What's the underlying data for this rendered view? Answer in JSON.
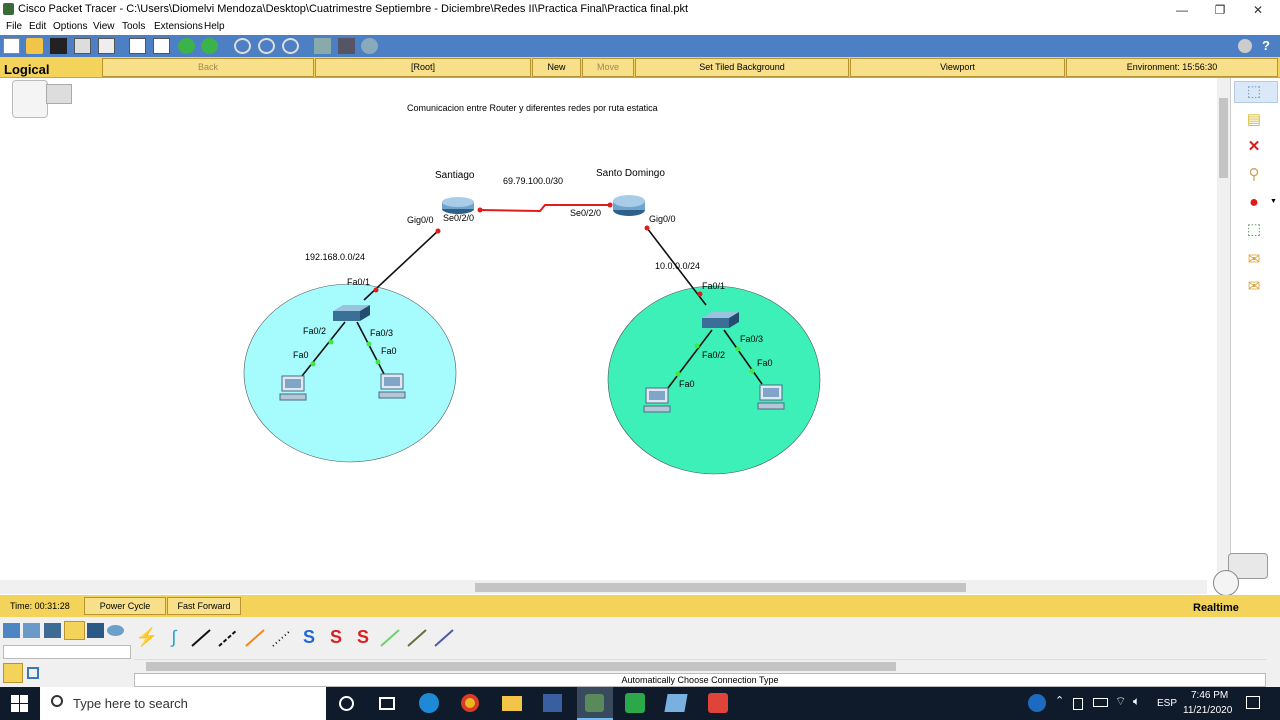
{
  "window": {
    "title": "Cisco Packet Tracer - C:\\Users\\Diomelvi Mendoza\\Desktop\\Cuatrimestre Septiembre - Diciembre\\Redes II\\Practica Final\\Practica final.pkt",
    "minimize": "—",
    "maximize": "❐",
    "close": "✕"
  },
  "menu": [
    "File",
    "Edit",
    "Options",
    "View",
    "Tools",
    "Extensions",
    "Help"
  ],
  "logical_bar": {
    "title": "Logical",
    "back": "Back",
    "root": "[Root]",
    "new_cluster": "New Cluster",
    "move_object": "Move Object",
    "set_tiled_background": "Set Tiled Background",
    "viewport": "Viewport",
    "environment": "Environment: 15:56:30"
  },
  "topology": {
    "title": "Comunicacion entre Router y diferentes redes por ruta estatica",
    "router_left": "Santiago",
    "router_right": "Santo Domingo",
    "wan_net": "69.79.100.0/30",
    "left_net": "192.168.0.0/24",
    "right_net": "10.0.0.0/24",
    "labels": {
      "gig_left": "Gig0/0",
      "se_left": "Se0/2/0",
      "se_right": "Se0/2/0",
      "gig_right": "Gig0/0",
      "sw_left_fa01": "Fa0/1",
      "sw_left_fa02": "Fa0/2",
      "sw_left_fa03": "Fa0/3",
      "pc_left1_fa0": "Fa0",
      "pc_left2_fa0": "Fa0",
      "sw_right_fa01": "Fa0/1",
      "sw_right_fa02": "Fa0/2",
      "sw_right_fa03": "Fa0/3",
      "pc_right1_fa0": "Fa0",
      "pc_right2_fa0": "Fa0"
    },
    "colors": {
      "left_cloud": "#a6fbfd",
      "right_cloud": "#3df0b8",
      "serial_link": "#e21a1a"
    }
  },
  "timebar": {
    "time": "Time: 00:31:28",
    "power_cycle": "Power Cycle Devices",
    "fast_forward": "Fast Forward Time",
    "mode": "Realtime"
  },
  "device_panel": {
    "status": "Automatically Choose Connection Type"
  },
  "taskbar": {
    "search_placeholder": "Type here to search",
    "lang": "ESP",
    "time": "7:46 PM",
    "date": "11/21/2020"
  }
}
